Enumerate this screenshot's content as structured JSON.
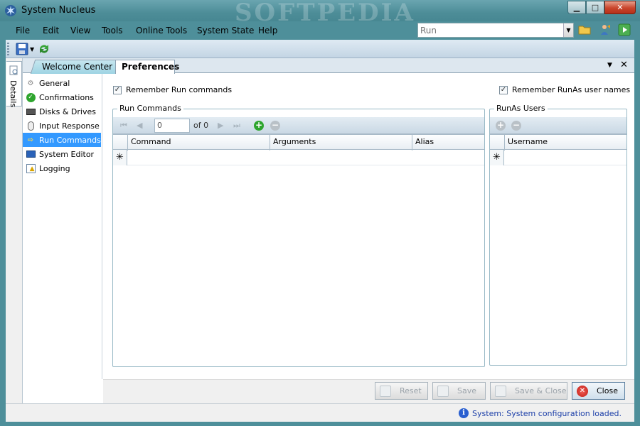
{
  "window": {
    "title": "System Nucleus",
    "watermark": "SOFTPEDIA"
  },
  "menu": [
    "File",
    "Edit",
    "View",
    "Tools",
    "Online Tools",
    "System State",
    "Help"
  ],
  "run_box": {
    "placeholder": "Run"
  },
  "details_label": "Details",
  "tabs": [
    {
      "label": "Welcome Center",
      "active": false
    },
    {
      "label": "Preferences",
      "active": true
    }
  ],
  "nav": [
    {
      "label": "General",
      "icon": "gear-icon"
    },
    {
      "label": "Confirmations",
      "icon": "check-circle-icon"
    },
    {
      "label": "Disks & Drives",
      "icon": "drive-icon"
    },
    {
      "label": "Input Response",
      "icon": "mouse-icon"
    },
    {
      "label": "Run Commands",
      "icon": "arrow-right-icon",
      "selected": true
    },
    {
      "label": "System Editor",
      "icon": "monitor-icon"
    },
    {
      "label": "Logging",
      "icon": "log-warning-icon"
    }
  ],
  "options": {
    "remember_run": "Remember Run commands",
    "remember_runas": "Remember RunAs user names"
  },
  "run_commands": {
    "title": "Run Commands",
    "position": "0",
    "of_total": "of 0",
    "columns": [
      "Command",
      "Arguments",
      "Alias"
    ],
    "new_row_marker": "✳"
  },
  "runas": {
    "title": "RunAs Users",
    "columns": [
      "Username"
    ],
    "new_row_marker": "✳"
  },
  "buttons": {
    "reset": "Reset",
    "save": "Save",
    "save_close": "Save & Close",
    "close": "Close"
  },
  "status": {
    "text": "System: System configuration loaded."
  }
}
